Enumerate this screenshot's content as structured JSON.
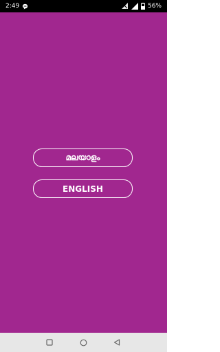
{
  "status_bar": {
    "time": "2:49",
    "battery": "56%",
    "icons": [
      "chat-bubble-icon",
      "wifi-icon",
      "signal-icon",
      "battery-icon"
    ]
  },
  "language_select": {
    "buttons": [
      {
        "label": "മലയാളം"
      },
      {
        "label": "ENGLISH"
      }
    ]
  },
  "navigation": {
    "icons": [
      "recents-square-icon",
      "home-circle-icon",
      "back-triangle-icon"
    ]
  },
  "colors": {
    "background": "#a1278f",
    "button_border": "#ffffff",
    "status_bar": "#000000",
    "nav_bar": "#e7e7e7"
  }
}
